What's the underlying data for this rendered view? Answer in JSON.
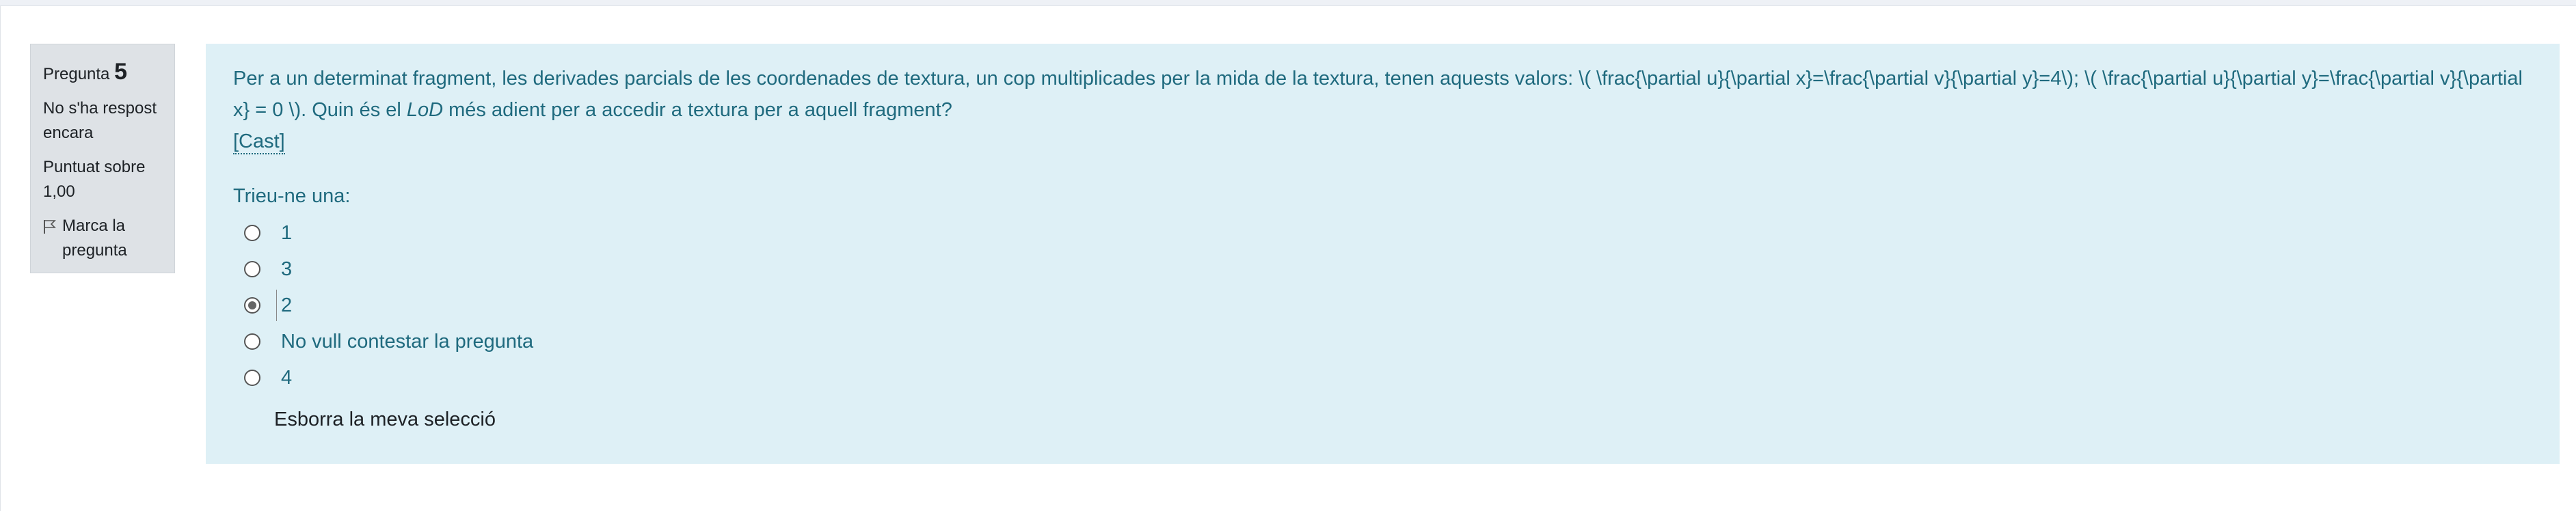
{
  "question_info": {
    "label": "Pregunta",
    "number": "5",
    "state": "No s'ha respost encara",
    "grade": "Puntuat sobre 1,00",
    "flag_label": "Marca la pregunta"
  },
  "question": {
    "text_part1": "Per a un determinat fragment, les derivades parcials de les coordenades de textura, un cop multiplicades per la mida de la textura, tenen aquests valors: \\( \\frac{\\partial u}{\\partial x}=\\frac{\\partial v}{\\partial y}=4\\); \\( \\frac{\\partial u}{\\partial y}=\\frac{\\partial v}{\\partial x} = 0 \\). Quin és el ",
    "text_em": "LoD",
    "text_part2": " més adient per a accedir a textura per a aquell fragment?",
    "cast_link": "[Cast]",
    "prompt": "Trieu-ne una:",
    "options": [
      {
        "label": "1",
        "checked": false
      },
      {
        "label": "3",
        "checked": false
      },
      {
        "label": "2",
        "checked": true
      },
      {
        "label": "No vull contestar la pregunta",
        "checked": false
      },
      {
        "label": "4",
        "checked": false
      }
    ],
    "clear_label": "Esborra la meva selecció"
  }
}
